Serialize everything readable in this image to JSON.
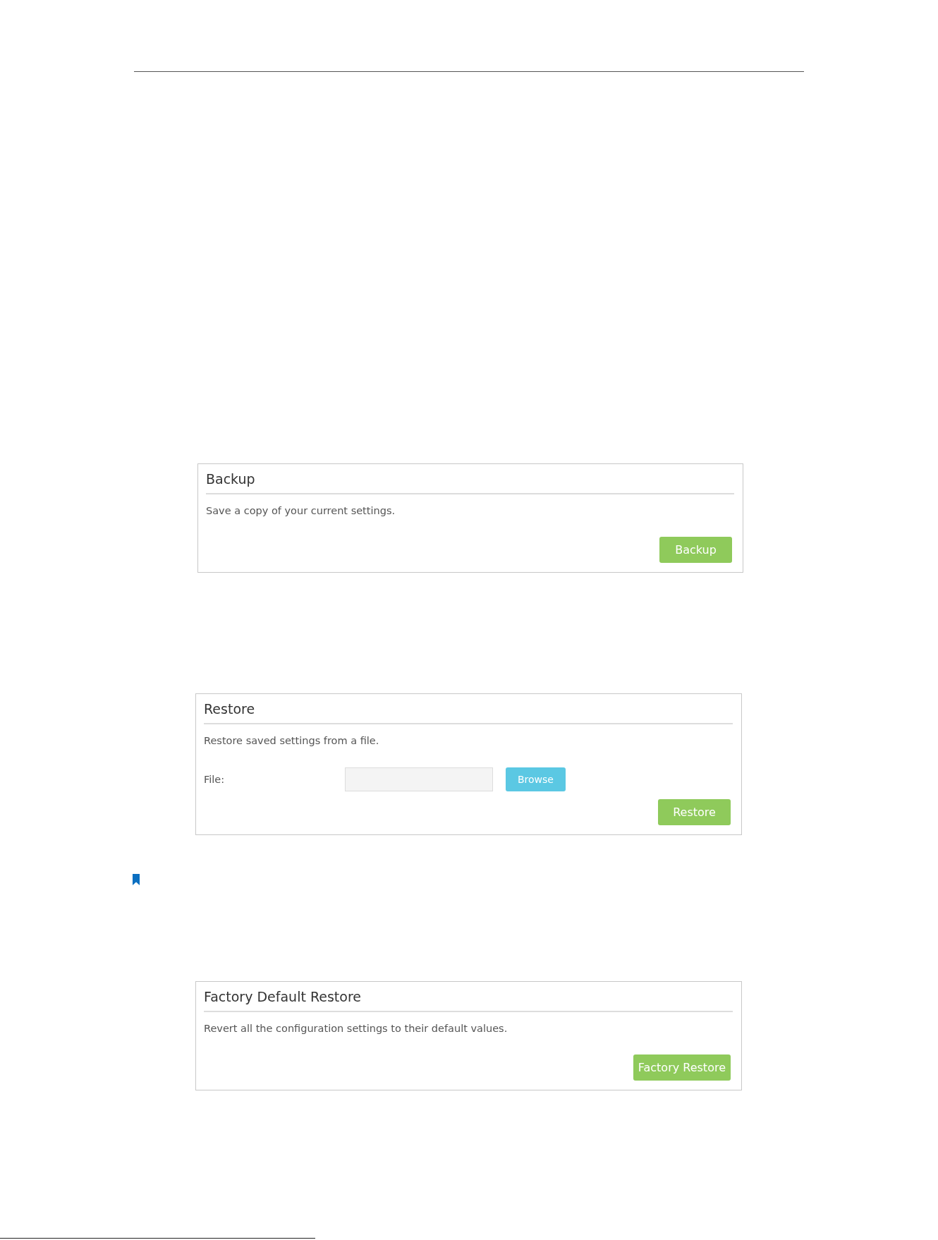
{
  "blocks": [
    {
      "kind": "panel",
      "title": "Backup",
      "description": "Save a copy of your current settings.",
      "action_button": "Backup"
    },
    {
      "kind": "panel",
      "title": "Restore",
      "description": "Restore saved settings from a file.",
      "file_field": {
        "label": "File:",
        "browse_button": "Browse"
      },
      "action_button": "Restore"
    },
    {
      "kind": "note_mark"
    },
    {
      "kind": "panel",
      "title": "Factory Default Restore",
      "description": "Revert all the configuration settings to their default values.",
      "action_button": "Factory Restore"
    }
  ]
}
